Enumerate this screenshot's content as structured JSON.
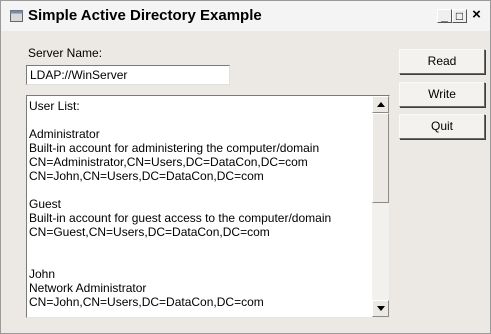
{
  "window": {
    "title": "Simple Active Directory Example",
    "controls": {
      "minimize": "_",
      "maximize": "□",
      "close": "×"
    }
  },
  "server": {
    "label": "Server Name:",
    "value": "LDAP://WinServer"
  },
  "buttons": {
    "read": "Read",
    "write": "Write",
    "quit": "Quit"
  },
  "user_list": {
    "text": "User List:\n\nAdministrator\nBuilt-in account for administering the computer/domain\nCN=Administrator,CN=Users,DC=DataCon,DC=com\nCN=John,CN=Users,DC=DataCon,DC=com\n\nGuest\nBuilt-in account for guest access to the computer/domain\nCN=Guest,CN=Users,DC=DataCon,DC=com\n\n\nJohn\nNetwork Administrator\nCN=John,CN=Users,DC=DataCon,DC=com"
  }
}
